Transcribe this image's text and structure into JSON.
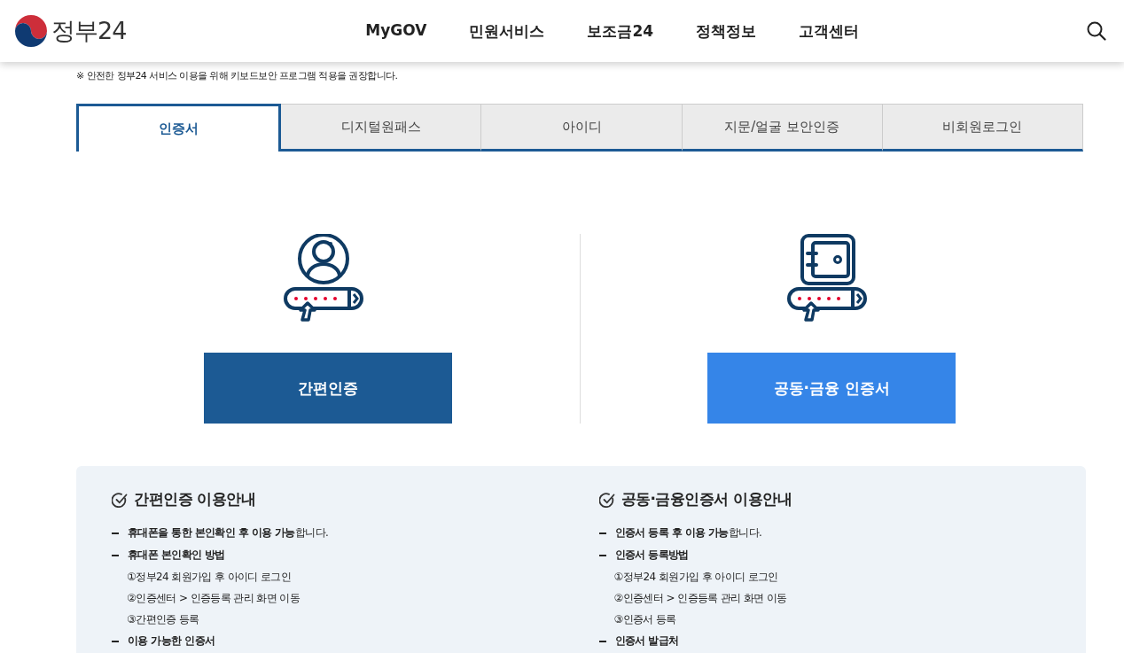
{
  "header": {
    "logo": "정부24",
    "nav": [
      "MyGOV",
      "민원서비스",
      "보조금24",
      "정책정보",
      "고객센터"
    ]
  },
  "notice": "※ 안전한 정부24 서비스 이용을 위해 키보드보안 프로그램 적용을 권장합니다.",
  "tabs": [
    {
      "label": "인증서",
      "selected": true
    },
    {
      "label": "디지털원패스",
      "selected": false
    },
    {
      "label": "아이디",
      "selected": false
    },
    {
      "label": "지문/얼굴 보안인증",
      "selected": false
    },
    {
      "label": "비회원로그인",
      "selected": false
    }
  ],
  "methods": [
    {
      "kind": "person",
      "button": "간편인증"
    },
    {
      "kind": "safe",
      "button": "공동·금융 인증서"
    }
  ],
  "guides": [
    {
      "title": "간편인증 이용안내",
      "items": [
        {
          "text": "**휴대폰을 통한 본인확인 후 이용 가능**합니다."
        },
        {
          "text": "**휴대폰 본인확인 방법**",
          "children": [
            "①정부24 회원가입 후 아이디 로그인",
            "②인증센터 > 인증등록 관리 화면 이동",
            "③간편인증 등록"
          ]
        },
        {
          "text": "**이용 가능한 인증서**"
        }
      ]
    },
    {
      "title": "공동·금융인증서 이용안내",
      "items": [
        {
          "text": "**인증서 등록 후 이용 가능**합니다."
        },
        {
          "text": "**인증서 등록방법**",
          "children": [
            "①정부24 회원가입 후 아이디 로그인",
            "②인증센터 > 인증등록 관리 화면 이동",
            "③인증서 등록"
          ]
        },
        {
          "text": "**인증서 발급처**"
        }
      ]
    }
  ]
}
